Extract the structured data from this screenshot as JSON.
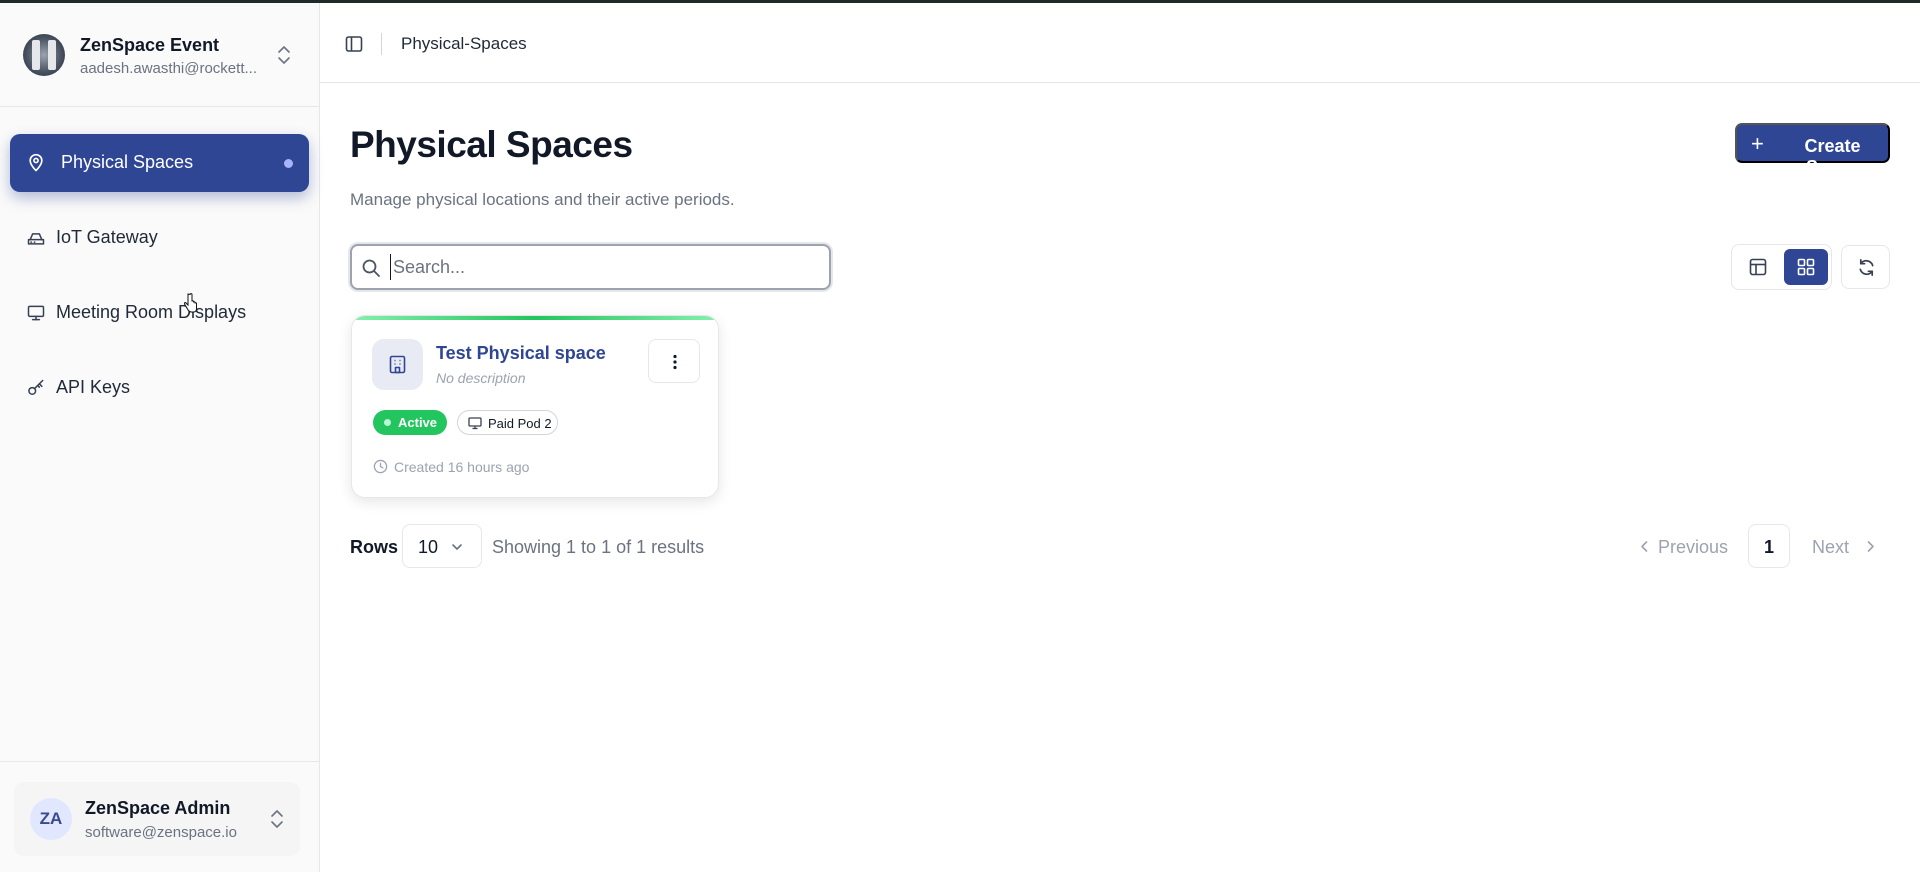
{
  "org": {
    "name": "ZenSpace Event",
    "email": "aadesh.awasthi@rockett..."
  },
  "sidebar": {
    "items": [
      {
        "label": "Physical Spaces",
        "icon": "map-pin-icon",
        "active": true
      },
      {
        "label": "IoT Gateway",
        "icon": "router-icon",
        "active": false
      },
      {
        "label": "Meeting Room Displays",
        "icon": "monitor-icon",
        "active": false
      },
      {
        "label": "API Keys",
        "icon": "key-icon",
        "active": false
      }
    ]
  },
  "user": {
    "initials": "ZA",
    "name": "ZenSpace Admin",
    "email": "software@zenspace.io"
  },
  "header": {
    "breadcrumb": "Physical-Spaces"
  },
  "main": {
    "title": "Physical Spaces",
    "subtitle": "Manage physical locations and their active periods.",
    "create_label": "Create Space",
    "search": {
      "placeholder": "Search...",
      "value": ""
    },
    "view_mode": "grid"
  },
  "cards": [
    {
      "title": "Test Physical space",
      "description": "No description",
      "status": "Active",
      "device": "Paid Pod 2",
      "created": "Created 16 hours ago"
    }
  ],
  "pagination": {
    "rows_label": "Rows",
    "rows_value": "10",
    "showing": "Showing 1 to 1 of 1 results",
    "previous": "Previous",
    "page": "1",
    "next": "Next"
  },
  "colors": {
    "primary": "#2e4694",
    "active_badge": "#22c55e",
    "muted": "#6b7280"
  }
}
